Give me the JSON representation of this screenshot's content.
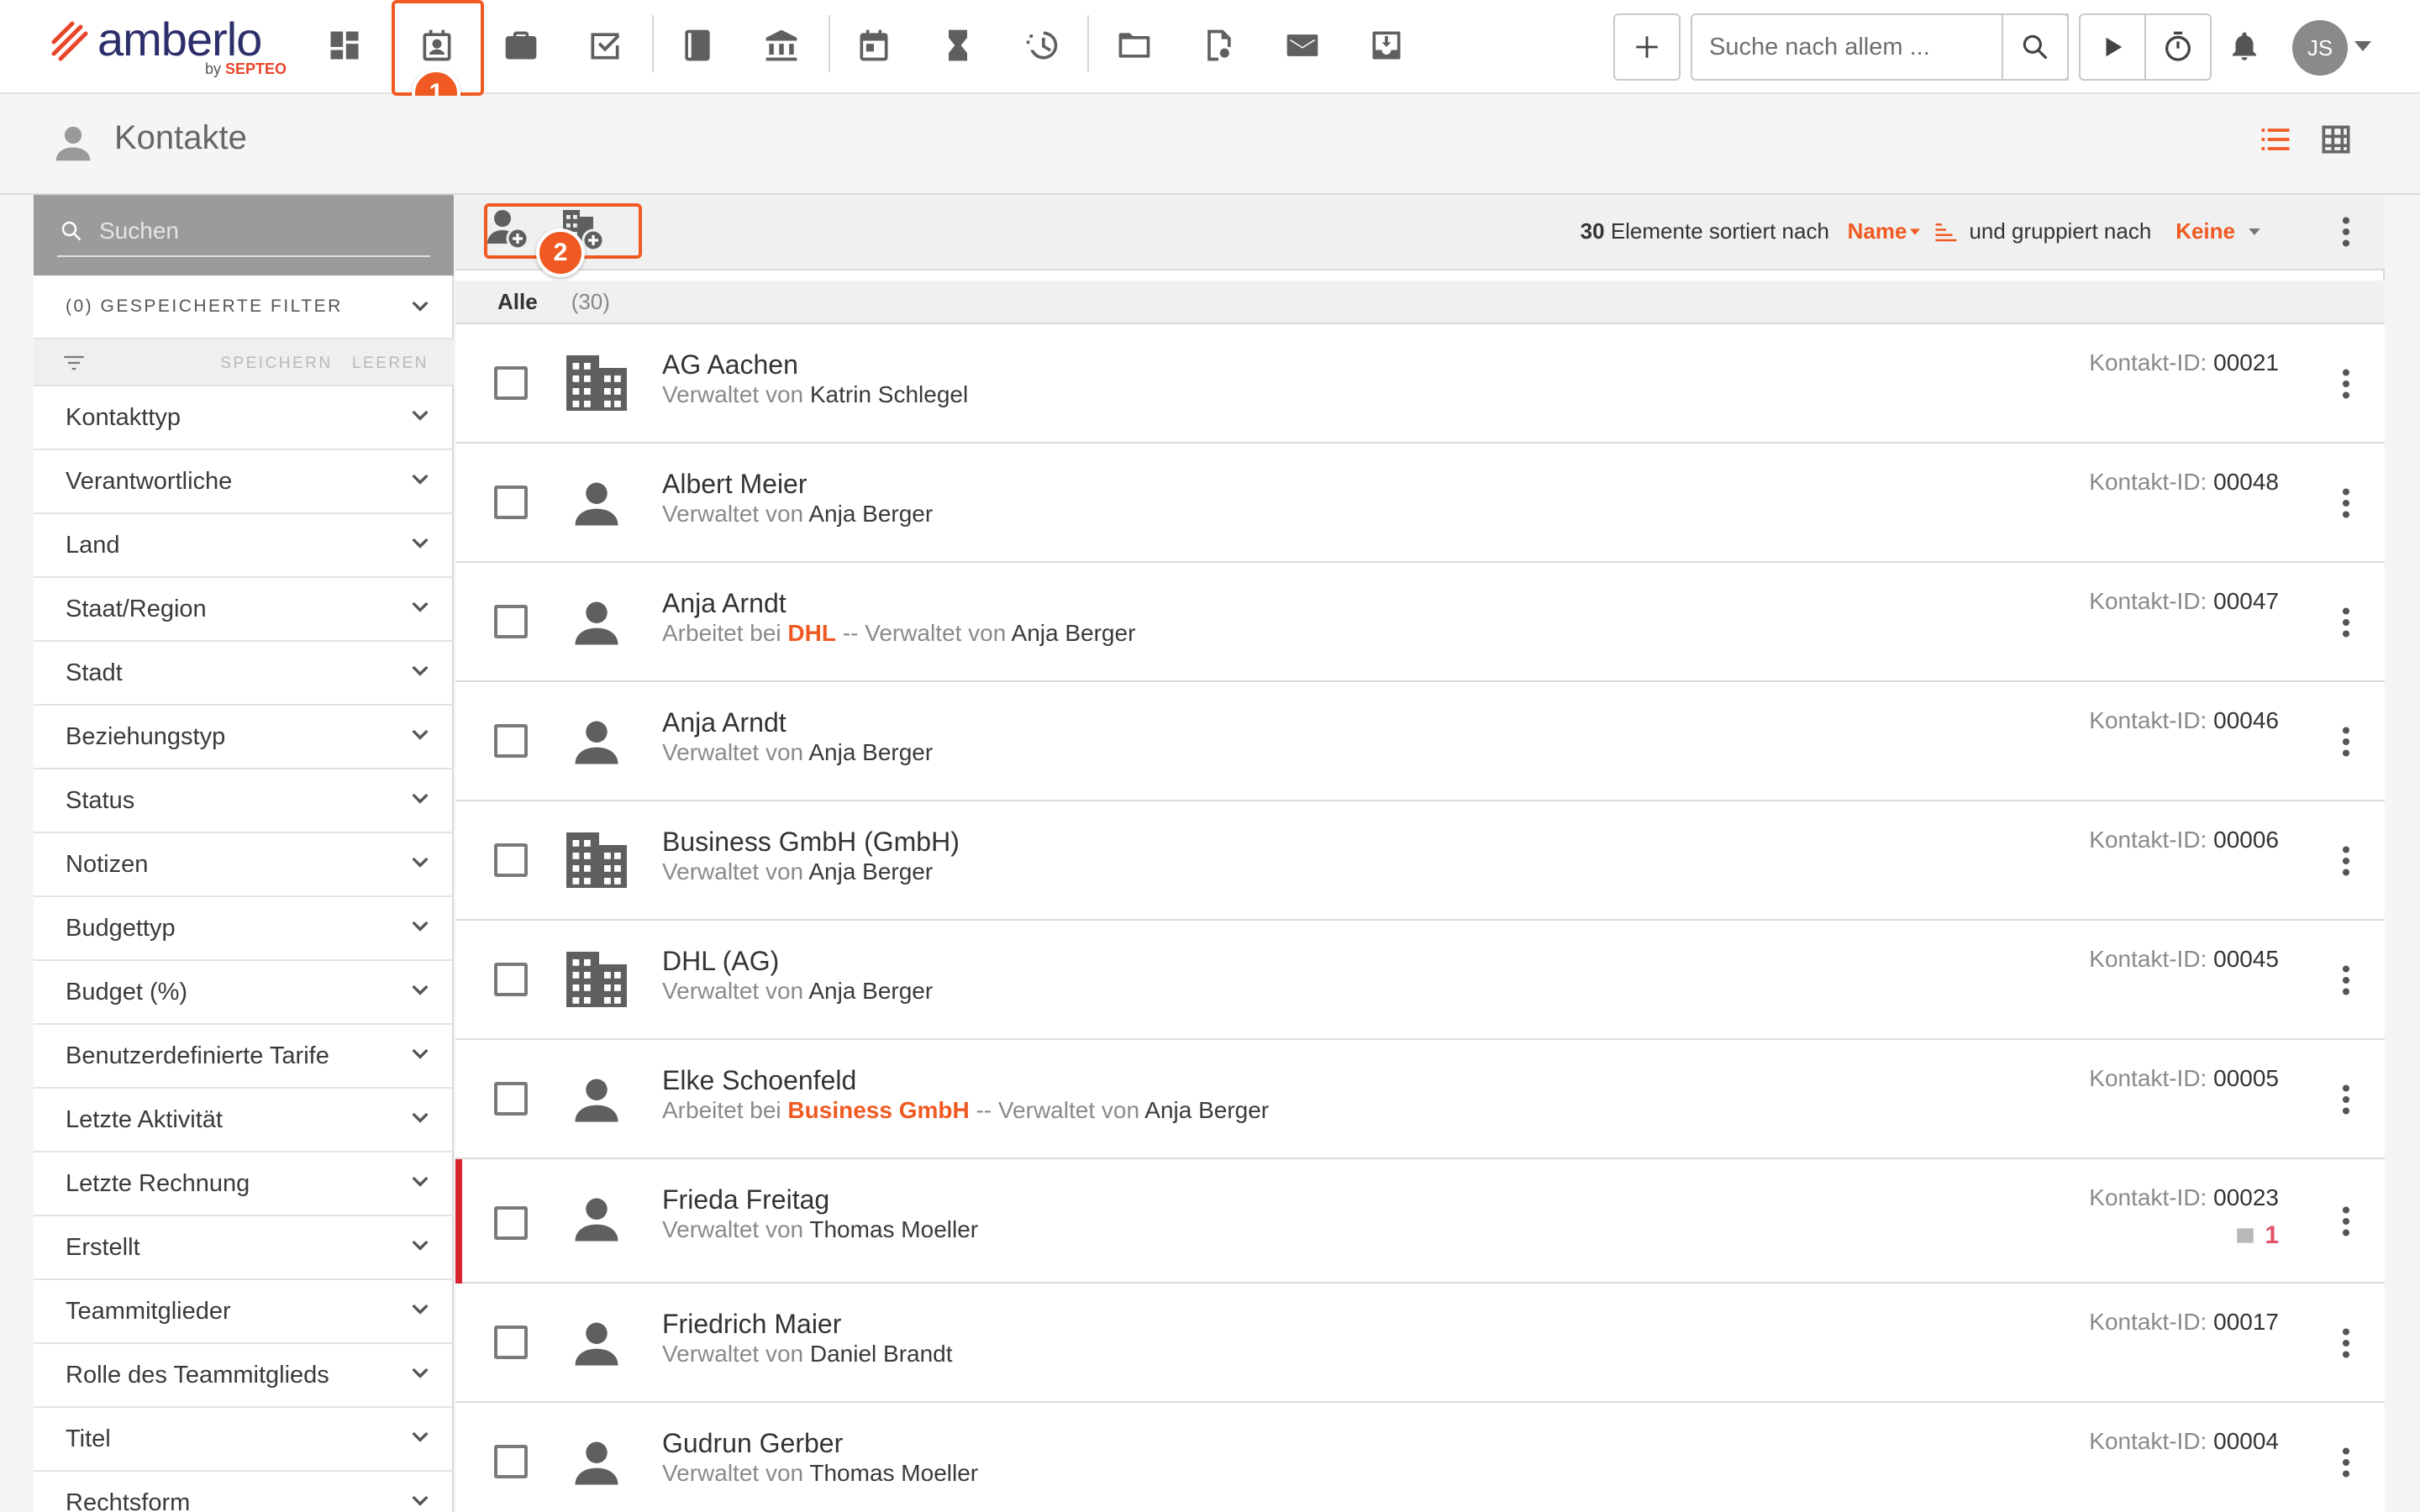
{
  "brand": {
    "name": "amberlo",
    "by": "by",
    "by_brand": "SEPTEO"
  },
  "nav": {
    "icons": [
      "dashboard-icon",
      "contacts-icon",
      "briefcase-icon",
      "tasks-icon",
      "book-icon",
      "bank-icon",
      "calendar-icon",
      "hourglass-icon",
      "billing-icon",
      "folder-icon",
      "document-search-icon",
      "mail-icon",
      "inbox-download-icon"
    ],
    "active": "contacts-icon",
    "callout_1": "1"
  },
  "topbar": {
    "search_placeholder": "Suche nach allem ...",
    "avatar_initials": "JS"
  },
  "page": {
    "title": "Kontakte"
  },
  "sidebar": {
    "search_placeholder": "Suchen",
    "saved_filters": "(0) GESPEICHERTE FILTER",
    "save_label": "SPEICHERN",
    "clear_label": "LEEREN",
    "filters": [
      "Kontakttyp",
      "Verantwortliche",
      "Land",
      "Staat/Region",
      "Stadt",
      "Beziehungstyp",
      "Status",
      "Notizen",
      "Budgettyp",
      "Budget (%)",
      "Benutzerdefinierte Tarife",
      "Letzte Aktivität",
      "Letzte Rechnung",
      "Erstellt",
      "Teammitglieder",
      "Rolle des Teammitglieds",
      "Titel",
      "Rechtsform"
    ]
  },
  "toolbar": {
    "callout_2": "2",
    "count": "30",
    "count_text": "Elemente sortiert nach",
    "sort_value": "Name",
    "group_text": "und gruppiert nach",
    "group_value": "Keine"
  },
  "group": {
    "label": "Alle",
    "count": "(30)"
  },
  "labels": {
    "managed_by": "Verwaltet von",
    "works_at": "Arbeitet bei",
    "sep": "--",
    "contact_id": "Kontakt-ID:"
  },
  "contacts": [
    {
      "type": "company",
      "name": "AG Aachen",
      "manager": "Katrin Schlegel",
      "id": "00021"
    },
    {
      "type": "person",
      "name": "Albert Meier",
      "manager": "Anja Berger",
      "id": "00048"
    },
    {
      "type": "person",
      "name": "Anja Arndt",
      "employer": "DHL",
      "manager": "Anja Berger",
      "id": "00047"
    },
    {
      "type": "person",
      "name": "Anja Arndt",
      "manager": "Anja Berger",
      "id": "00046"
    },
    {
      "type": "company",
      "name": "Business GmbH (GmbH)",
      "manager": "Anja Berger",
      "id": "00006"
    },
    {
      "type": "company",
      "name": "DHL (AG)",
      "manager": "Anja Berger",
      "id": "00045"
    },
    {
      "type": "person",
      "name": "Elke Schoenfeld",
      "employer": "Business GmbH",
      "manager": "Anja Berger",
      "id": "00005"
    },
    {
      "type": "person",
      "name": "Frieda Freitag",
      "manager": "Thomas Moeller",
      "id": "00023",
      "flagged": true,
      "task_count": "1"
    },
    {
      "type": "person",
      "name": "Friedrich Maier",
      "manager": "Daniel Brandt",
      "id": "00017"
    },
    {
      "type": "person",
      "name": "Gudrun Gerber",
      "manager": "Thomas Moeller",
      "id": "00004"
    }
  ],
  "colors": {
    "accent": "#f05a22",
    "flag": "#d9242f",
    "icon": "#5f5f5f"
  }
}
